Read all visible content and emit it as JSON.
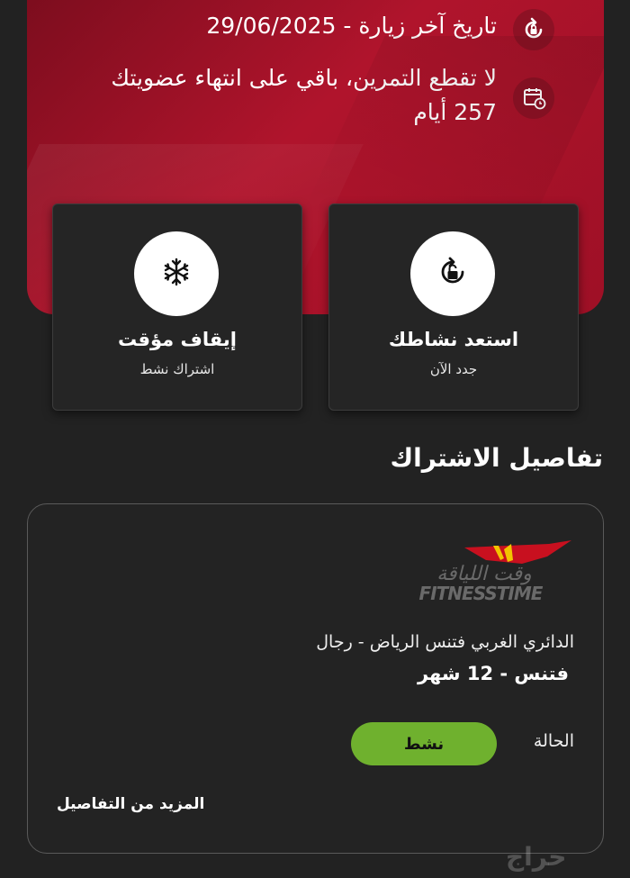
{
  "membership": {
    "last_visit": "تاريخ آخر زيارة - 29/06/2025",
    "remaining_line1": "لا تقطع التمرين، باقي على انتهاء عضويتك",
    "remaining_line2": "257 أيام"
  },
  "actions": {
    "freeze_title": "إيقاف مؤقت",
    "freeze_sub": "اشتراك نشط",
    "renew_title": "استعد نشاطك",
    "renew_sub": "جدد الآن"
  },
  "subscription": {
    "section_title": "تفاصيل الاشتراك",
    "logo_arabic": "وقت اللياقة",
    "logo_english": "FITNESSTIME",
    "branch": "الدائري الغربي فتنس الرياض - رجال",
    "plan": "فتنس - 12 شهر",
    "status_label": "الحالة",
    "status_value": "نشط",
    "more_details": "المزيد من التفاصيل"
  },
  "watermark": "حراج",
  "colors": {
    "accent": "#b0142c",
    "status": "#6fb12e",
    "background": "#222222"
  },
  "icons": [
    "refresh-icon",
    "calendar-clock-icon",
    "unlock-refresh-icon",
    "snowflake-icon"
  ]
}
